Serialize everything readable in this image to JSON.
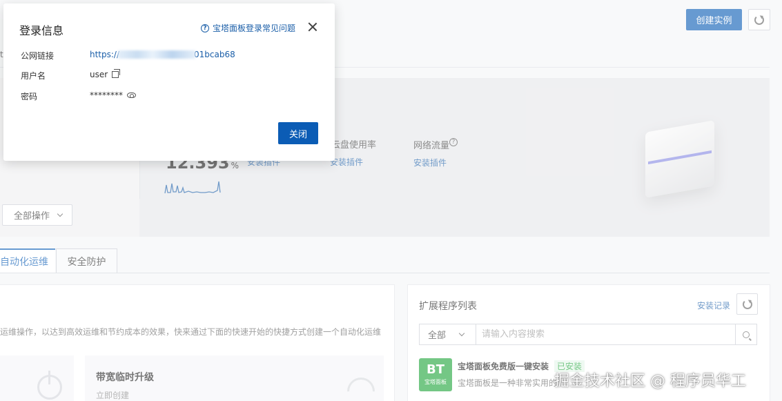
{
  "header": {
    "create_button": "创建实例",
    "left_edge_text": "t"
  },
  "hero": {
    "metrics": [
      {
        "label": "云盘使用率",
        "link": "安装插件"
      },
      {
        "label": "网络流量",
        "link": "安装插件"
      }
    ],
    "partial_link": "安装插件",
    "big_value": "12.393",
    "big_unit": "%"
  },
  "toolbar": {
    "all_actions": "全部操作"
  },
  "tabs": [
    {
      "label": "自动化运维",
      "active": true
    },
    {
      "label": "安全防护",
      "active": false
    }
  ],
  "left_card": {
    "description": "运维操作，以达到高效运维和节约成本的效果，快来通过下面的快速开始的快捷方式创建一个自动化运维",
    "quick_item_title": "带宽临时升级",
    "quick_item_link": "立即创建"
  },
  "extensions": {
    "title": "扩展程序列表",
    "install_record": "安装记录",
    "filter_selected": "全部",
    "search_placeholder": "请输入内容搜索",
    "plugins": [
      {
        "logo_big": "BT",
        "logo_small": "宝塔面板",
        "name": "宝塔面板免费版一键安装",
        "status": "已安装",
        "description": "宝塔面板是一种非常实用的",
        "status_color": "#20a53a"
      }
    ]
  },
  "dialog": {
    "title": "登录信息",
    "help_link": "宝塔面板登录常见问题",
    "rows": [
      {
        "label": "公网链接",
        "value_prefix": "https://",
        "value_suffix": "01bcab68"
      },
      {
        "label": "用户名",
        "value": "user"
      },
      {
        "label": "密码",
        "value": "********"
      }
    ],
    "close_button": "关闭"
  },
  "watermark": "掘金技术社区 @ 程序员华工",
  "colors": {
    "primary": "#0b5cb5",
    "link": "#1a5ea8",
    "success": "#20a53a"
  }
}
